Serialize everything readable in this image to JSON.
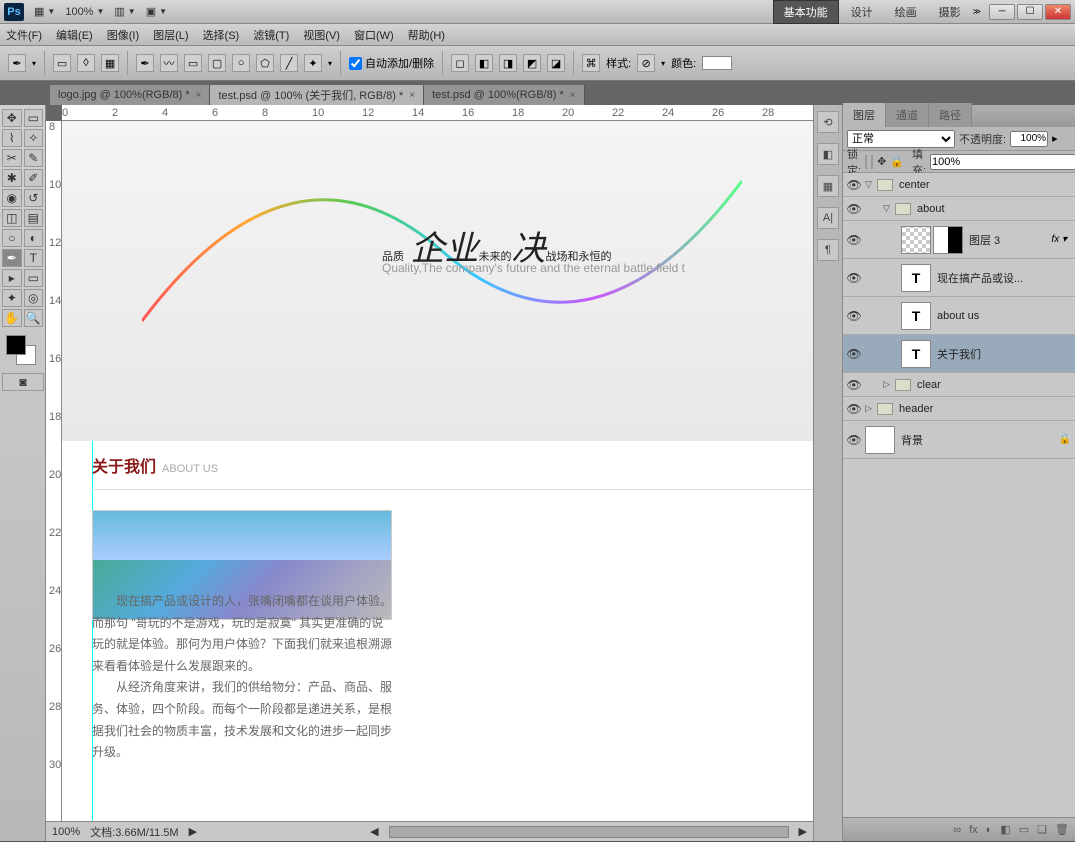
{
  "title": {
    "zoom": "100%",
    "workspace_active": "基本功能",
    "workspaces": [
      "设计",
      "绘画",
      "摄影"
    ]
  },
  "menus": [
    "文件(F)",
    "编辑(E)",
    "图像(I)",
    "图层(L)",
    "选择(S)",
    "滤镜(T)",
    "视图(V)",
    "窗口(W)",
    "帮助(H)"
  ],
  "optbar": {
    "autoadd": "自动添加/删除",
    "style": "样式:",
    "color": "颜色:"
  },
  "tabs": [
    {
      "label": "logo.jpg @ 100%(RGB/8) *",
      "active": false
    },
    {
      "label": "test.psd @ 100% (关于我们, RGB/8) *",
      "active": true
    },
    {
      "label": "test.psd @ 100%(RGB/8) *",
      "active": false
    }
  ],
  "ruler_h": [
    "0",
    "2",
    "4",
    "6",
    "8",
    "10",
    "12",
    "14",
    "16",
    "18",
    "20",
    "22",
    "24",
    "26",
    "28"
  ],
  "ruler_v": [
    "8",
    "10",
    "12",
    "14",
    "16",
    "18",
    "20",
    "22",
    "24",
    "26",
    "28",
    "30"
  ],
  "canvas": {
    "headline_pre": "品质",
    "headline_em1": "企业",
    "headline_mid": "未来的",
    "headline_em2": "决",
    "headline_post": "战场和永恒的",
    "sub": "Quality,The company's future and the eternal battle field t",
    "about_cn": "关于我们",
    "about_en": "ABOUT US",
    "para": "　　现在搞产品或设计的人，张嘴闭嘴都在谈用户体验。而那句 \"哥玩的不是游戏，玩的是寂寞\" 其实更准确的说玩的就是体验。那何为用户体验？下面我们就来追根溯源来看看体验是什么发展跟来的。\n　　从经济角度来讲，我们的供给物分：产品、商品、服务、体验，四个阶段。而每个一阶段都是递进关系，是根据我们社会的物质丰富，技术发展和文化的进步一起同步升级。"
  },
  "status": {
    "zoom": "100%",
    "doc": "文档:3.66M/11.5M"
  },
  "layerspanel": {
    "tabs": [
      "图层",
      "通道",
      "路径"
    ],
    "blend": "正常",
    "opacity_lbl": "不透明度:",
    "opacity": "100%",
    "lock_lbl": "锁定:",
    "fill_lbl": "填充:",
    "fill": "100%",
    "layers": [
      {
        "type": "group",
        "name": "center",
        "indent": 0,
        "open": true
      },
      {
        "type": "group",
        "name": "about",
        "indent": 1,
        "open": true
      },
      {
        "type": "masked",
        "name": "图层 3",
        "indent": 2,
        "fx": true
      },
      {
        "type": "text",
        "name": "现在搞产品或设...",
        "indent": 2
      },
      {
        "type": "text",
        "name": "about us",
        "indent": 2
      },
      {
        "type": "text",
        "name": "关于我们",
        "indent": 2,
        "sel": true
      },
      {
        "type": "group",
        "name": "clear",
        "indent": 1,
        "open": false
      },
      {
        "type": "group",
        "name": "header",
        "indent": 0,
        "open": false
      },
      {
        "type": "bg",
        "name": "背景",
        "indent": 0,
        "lock": true
      }
    ],
    "foot": [
      "∞",
      "fx",
      "◐",
      "◧",
      "▭",
      "❏",
      "🗑"
    ]
  }
}
